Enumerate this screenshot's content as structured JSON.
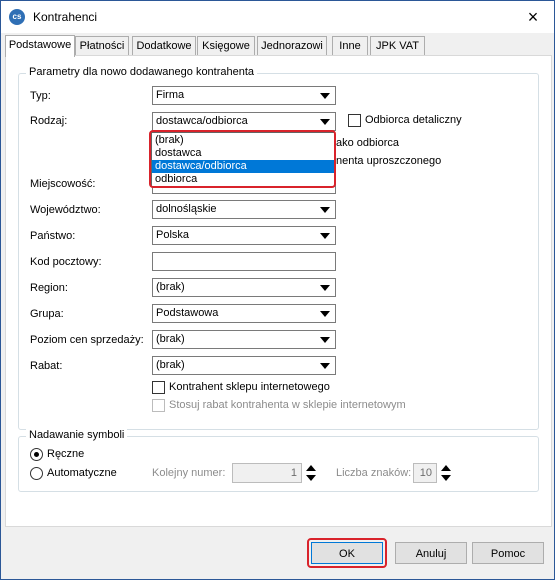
{
  "window": {
    "title": "Kontrahenci",
    "close": "×"
  },
  "tabs": [
    "Podstawowe",
    "Płatności",
    "Dodatkowe",
    "Księgowe",
    "Jednorazowi",
    "Inne",
    "JPK VAT"
  ],
  "params": {
    "legend": "Parametry dla nowo dodawanego kontrahenta",
    "typ_label": "Typ:",
    "typ_value": "Firma",
    "rodzaj_label": "Rodzaj:",
    "rodzaj_value": "dostawca/odbiorca",
    "odbiorca_detaliczny": "Odbiorca detaliczny",
    "hidden_text_1": "ako odbiorca",
    "hidden_text_2": "nenta uproszczonego",
    "rodzaj_options": [
      "(brak)",
      "dostawca",
      "dostawca/odbiorca",
      "odbiorca"
    ],
    "miejscowosc_label": "Miejscowość:",
    "wojewodztwo_label": "Województwo:",
    "wojewodztwo_value": "dolnośląskie",
    "panstwo_label": "Państwo:",
    "panstwo_value": "Polska",
    "kod_label": "Kod pocztowy:",
    "region_label": "Region:",
    "region_value": "(brak)",
    "grupa_label": "Grupa:",
    "grupa_value": "Podstawowa",
    "poziom_label": "Poziom cen sprzedaży:",
    "poziom_value": "(brak)",
    "rabat_label": "Rabat:",
    "rabat_value": "(brak)",
    "sklep_label": "Kontrahent sklepu internetowego",
    "stosuj_label": "Stosuj rabat kontrahenta w sklepie internetowym"
  },
  "symbols": {
    "legend": "Nadawanie symboli",
    "reczne": "Ręczne",
    "auto": "Automatyczne",
    "kolejny_label": "Kolejny numer:",
    "kolejny_value": "1",
    "liczba_label": "Liczba znaków:",
    "liczba_value": "10"
  },
  "buttons": {
    "ok": "OK",
    "anuluj": "Anuluj",
    "pomoc": "Pomoc"
  },
  "colors": {
    "selection": "#0078d7",
    "highlight": "#d9232b"
  }
}
